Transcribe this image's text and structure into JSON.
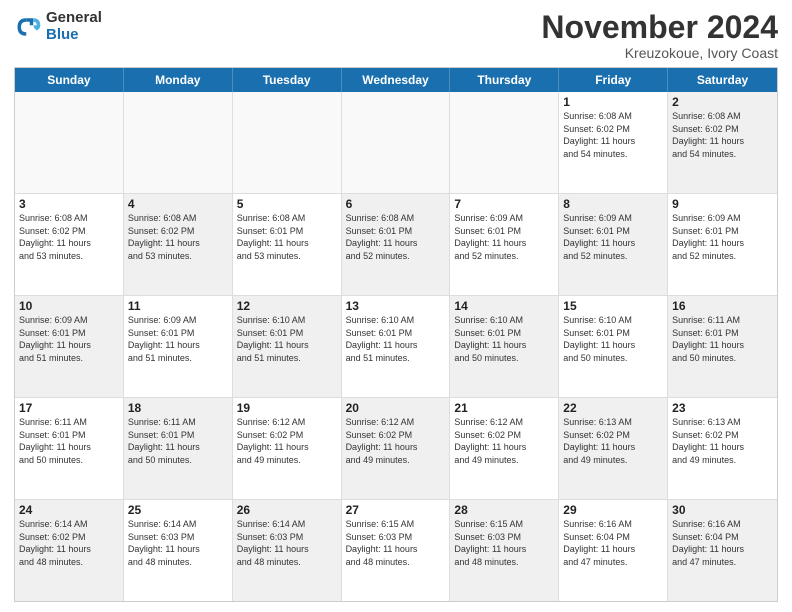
{
  "logo": {
    "general": "General",
    "blue": "Blue"
  },
  "header": {
    "month": "November 2024",
    "location": "Kreuzokoue, Ivory Coast"
  },
  "weekdays": [
    "Sunday",
    "Monday",
    "Tuesday",
    "Wednesday",
    "Thursday",
    "Friday",
    "Saturday"
  ],
  "weeks": [
    [
      {
        "day": "",
        "info": "",
        "empty": true
      },
      {
        "day": "",
        "info": "",
        "empty": true
      },
      {
        "day": "",
        "info": "",
        "empty": true
      },
      {
        "day": "",
        "info": "",
        "empty": true
      },
      {
        "day": "",
        "info": "",
        "empty": true
      },
      {
        "day": "1",
        "info": "Sunrise: 6:08 AM\nSunset: 6:02 PM\nDaylight: 11 hours\nand 54 minutes.",
        "shaded": false
      },
      {
        "day": "2",
        "info": "Sunrise: 6:08 AM\nSunset: 6:02 PM\nDaylight: 11 hours\nand 54 minutes.",
        "shaded": true
      }
    ],
    [
      {
        "day": "3",
        "info": "Sunrise: 6:08 AM\nSunset: 6:02 PM\nDaylight: 11 hours\nand 53 minutes.",
        "shaded": false
      },
      {
        "day": "4",
        "info": "Sunrise: 6:08 AM\nSunset: 6:02 PM\nDaylight: 11 hours\nand 53 minutes.",
        "shaded": true
      },
      {
        "day": "5",
        "info": "Sunrise: 6:08 AM\nSunset: 6:01 PM\nDaylight: 11 hours\nand 53 minutes.",
        "shaded": false
      },
      {
        "day": "6",
        "info": "Sunrise: 6:08 AM\nSunset: 6:01 PM\nDaylight: 11 hours\nand 52 minutes.",
        "shaded": true
      },
      {
        "day": "7",
        "info": "Sunrise: 6:09 AM\nSunset: 6:01 PM\nDaylight: 11 hours\nand 52 minutes.",
        "shaded": false
      },
      {
        "day": "8",
        "info": "Sunrise: 6:09 AM\nSunset: 6:01 PM\nDaylight: 11 hours\nand 52 minutes.",
        "shaded": true
      },
      {
        "day": "9",
        "info": "Sunrise: 6:09 AM\nSunset: 6:01 PM\nDaylight: 11 hours\nand 52 minutes.",
        "shaded": false
      }
    ],
    [
      {
        "day": "10",
        "info": "Sunrise: 6:09 AM\nSunset: 6:01 PM\nDaylight: 11 hours\nand 51 minutes.",
        "shaded": true
      },
      {
        "day": "11",
        "info": "Sunrise: 6:09 AM\nSunset: 6:01 PM\nDaylight: 11 hours\nand 51 minutes.",
        "shaded": false
      },
      {
        "day": "12",
        "info": "Sunrise: 6:10 AM\nSunset: 6:01 PM\nDaylight: 11 hours\nand 51 minutes.",
        "shaded": true
      },
      {
        "day": "13",
        "info": "Sunrise: 6:10 AM\nSunset: 6:01 PM\nDaylight: 11 hours\nand 51 minutes.",
        "shaded": false
      },
      {
        "day": "14",
        "info": "Sunrise: 6:10 AM\nSunset: 6:01 PM\nDaylight: 11 hours\nand 50 minutes.",
        "shaded": true
      },
      {
        "day": "15",
        "info": "Sunrise: 6:10 AM\nSunset: 6:01 PM\nDaylight: 11 hours\nand 50 minutes.",
        "shaded": false
      },
      {
        "day": "16",
        "info": "Sunrise: 6:11 AM\nSunset: 6:01 PM\nDaylight: 11 hours\nand 50 minutes.",
        "shaded": true
      }
    ],
    [
      {
        "day": "17",
        "info": "Sunrise: 6:11 AM\nSunset: 6:01 PM\nDaylight: 11 hours\nand 50 minutes.",
        "shaded": false
      },
      {
        "day": "18",
        "info": "Sunrise: 6:11 AM\nSunset: 6:01 PM\nDaylight: 11 hours\nand 50 minutes.",
        "shaded": true
      },
      {
        "day": "19",
        "info": "Sunrise: 6:12 AM\nSunset: 6:02 PM\nDaylight: 11 hours\nand 49 minutes.",
        "shaded": false
      },
      {
        "day": "20",
        "info": "Sunrise: 6:12 AM\nSunset: 6:02 PM\nDaylight: 11 hours\nand 49 minutes.",
        "shaded": true
      },
      {
        "day": "21",
        "info": "Sunrise: 6:12 AM\nSunset: 6:02 PM\nDaylight: 11 hours\nand 49 minutes.",
        "shaded": false
      },
      {
        "day": "22",
        "info": "Sunrise: 6:13 AM\nSunset: 6:02 PM\nDaylight: 11 hours\nand 49 minutes.",
        "shaded": true
      },
      {
        "day": "23",
        "info": "Sunrise: 6:13 AM\nSunset: 6:02 PM\nDaylight: 11 hours\nand 49 minutes.",
        "shaded": false
      }
    ],
    [
      {
        "day": "24",
        "info": "Sunrise: 6:14 AM\nSunset: 6:02 PM\nDaylight: 11 hours\nand 48 minutes.",
        "shaded": true
      },
      {
        "day": "25",
        "info": "Sunrise: 6:14 AM\nSunset: 6:03 PM\nDaylight: 11 hours\nand 48 minutes.",
        "shaded": false
      },
      {
        "day": "26",
        "info": "Sunrise: 6:14 AM\nSunset: 6:03 PM\nDaylight: 11 hours\nand 48 minutes.",
        "shaded": true
      },
      {
        "day": "27",
        "info": "Sunrise: 6:15 AM\nSunset: 6:03 PM\nDaylight: 11 hours\nand 48 minutes.",
        "shaded": false
      },
      {
        "day": "28",
        "info": "Sunrise: 6:15 AM\nSunset: 6:03 PM\nDaylight: 11 hours\nand 48 minutes.",
        "shaded": true
      },
      {
        "day": "29",
        "info": "Sunrise: 6:16 AM\nSunset: 6:04 PM\nDaylight: 11 hours\nand 47 minutes.",
        "shaded": false
      },
      {
        "day": "30",
        "info": "Sunrise: 6:16 AM\nSunset: 6:04 PM\nDaylight: 11 hours\nand 47 minutes.",
        "shaded": true
      }
    ]
  ]
}
